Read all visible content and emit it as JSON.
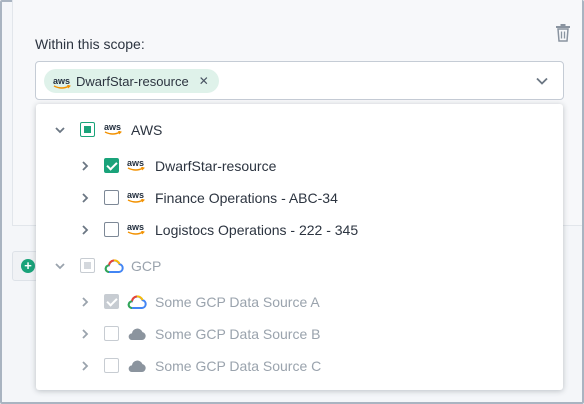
{
  "form": {
    "scope_label": "Within this scope:",
    "selected_chip": {
      "label": "DwarfStar-resource",
      "logo": "aws-logo"
    }
  },
  "tree": {
    "groups": [
      {
        "label": "AWS",
        "state": "partial",
        "expanded": true,
        "disabled": false,
        "logo": "aws-logo",
        "children": [
          {
            "label": "DwarfStar-resource",
            "checked": true,
            "logo": "aws-logo"
          },
          {
            "label": "Finance Operations - ABC-34",
            "checked": false,
            "logo": "aws-logo"
          },
          {
            "label": "Logistocs Operations - 222 - 345",
            "checked": false,
            "logo": "aws-logo"
          }
        ]
      },
      {
        "label": "GCP",
        "state": "partial",
        "expanded": true,
        "disabled": true,
        "logo": "gcp-cloud-icon",
        "children": [
          {
            "label": "Some GCP Data Source A",
            "checked": true,
            "logo": "gcp-cloud-icon"
          },
          {
            "label": "Some GCP Data Source B",
            "checked": false,
            "logo": "cloud-icon"
          },
          {
            "label": "Some GCP Data Source C",
            "checked": false,
            "logo": "cloud-icon"
          }
        ]
      }
    ]
  },
  "colors": {
    "accent": "#1aa37a",
    "chip_bg": "#dff2ea",
    "disabled_text": "#9aa3ad",
    "text": "#2c3440"
  }
}
